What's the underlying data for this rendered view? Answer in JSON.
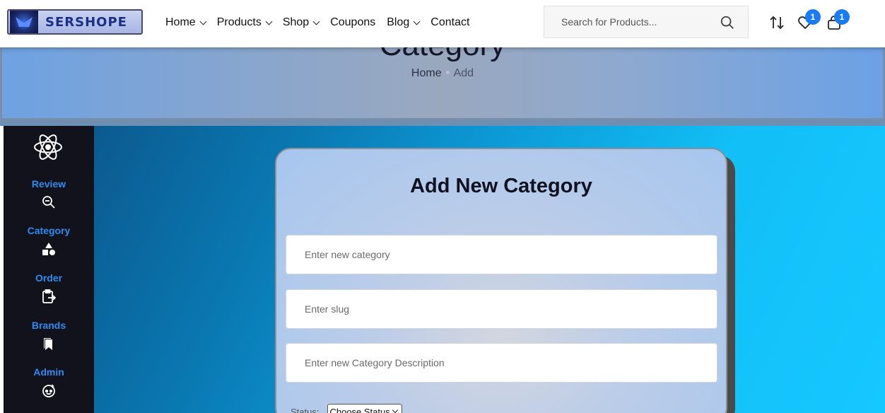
{
  "header": {
    "logo_text": "SERSHOPE",
    "nav": [
      {
        "label": "Home",
        "dropdown": true
      },
      {
        "label": "Products",
        "dropdown": true
      },
      {
        "label": "Shop",
        "dropdown": true
      },
      {
        "label": "Coupons",
        "dropdown": false
      },
      {
        "label": "Blog",
        "dropdown": true
      },
      {
        "label": "Contact",
        "dropdown": false
      }
    ],
    "search": {
      "placeholder": "Search for Products..."
    },
    "wishlist_count": "1",
    "cart_count": "1",
    "badge_color": "#1a7cf5"
  },
  "hero": {
    "title": "Category",
    "breadcrumb": [
      "Home",
      "Add"
    ]
  },
  "sidebar": {
    "items": [
      {
        "label": "Review",
        "icon": "zoom-out-icon"
      },
      {
        "label": "Category",
        "icon": "shapes-icon"
      },
      {
        "label": "Order",
        "icon": "clipboard-arrow-icon"
      },
      {
        "label": "Brands",
        "icon": "bookmarks-icon"
      },
      {
        "label": "Admin",
        "icon": "user-sparkle-icon"
      }
    ],
    "accent_color": "#2e8cf0"
  },
  "form": {
    "title": "Add New Category",
    "category_placeholder": "Enter new category",
    "slug_placeholder": "Enter slug",
    "description_placeholder": "Enter new Category Description",
    "status_label": "Status:",
    "status_value": "Choose Status"
  }
}
